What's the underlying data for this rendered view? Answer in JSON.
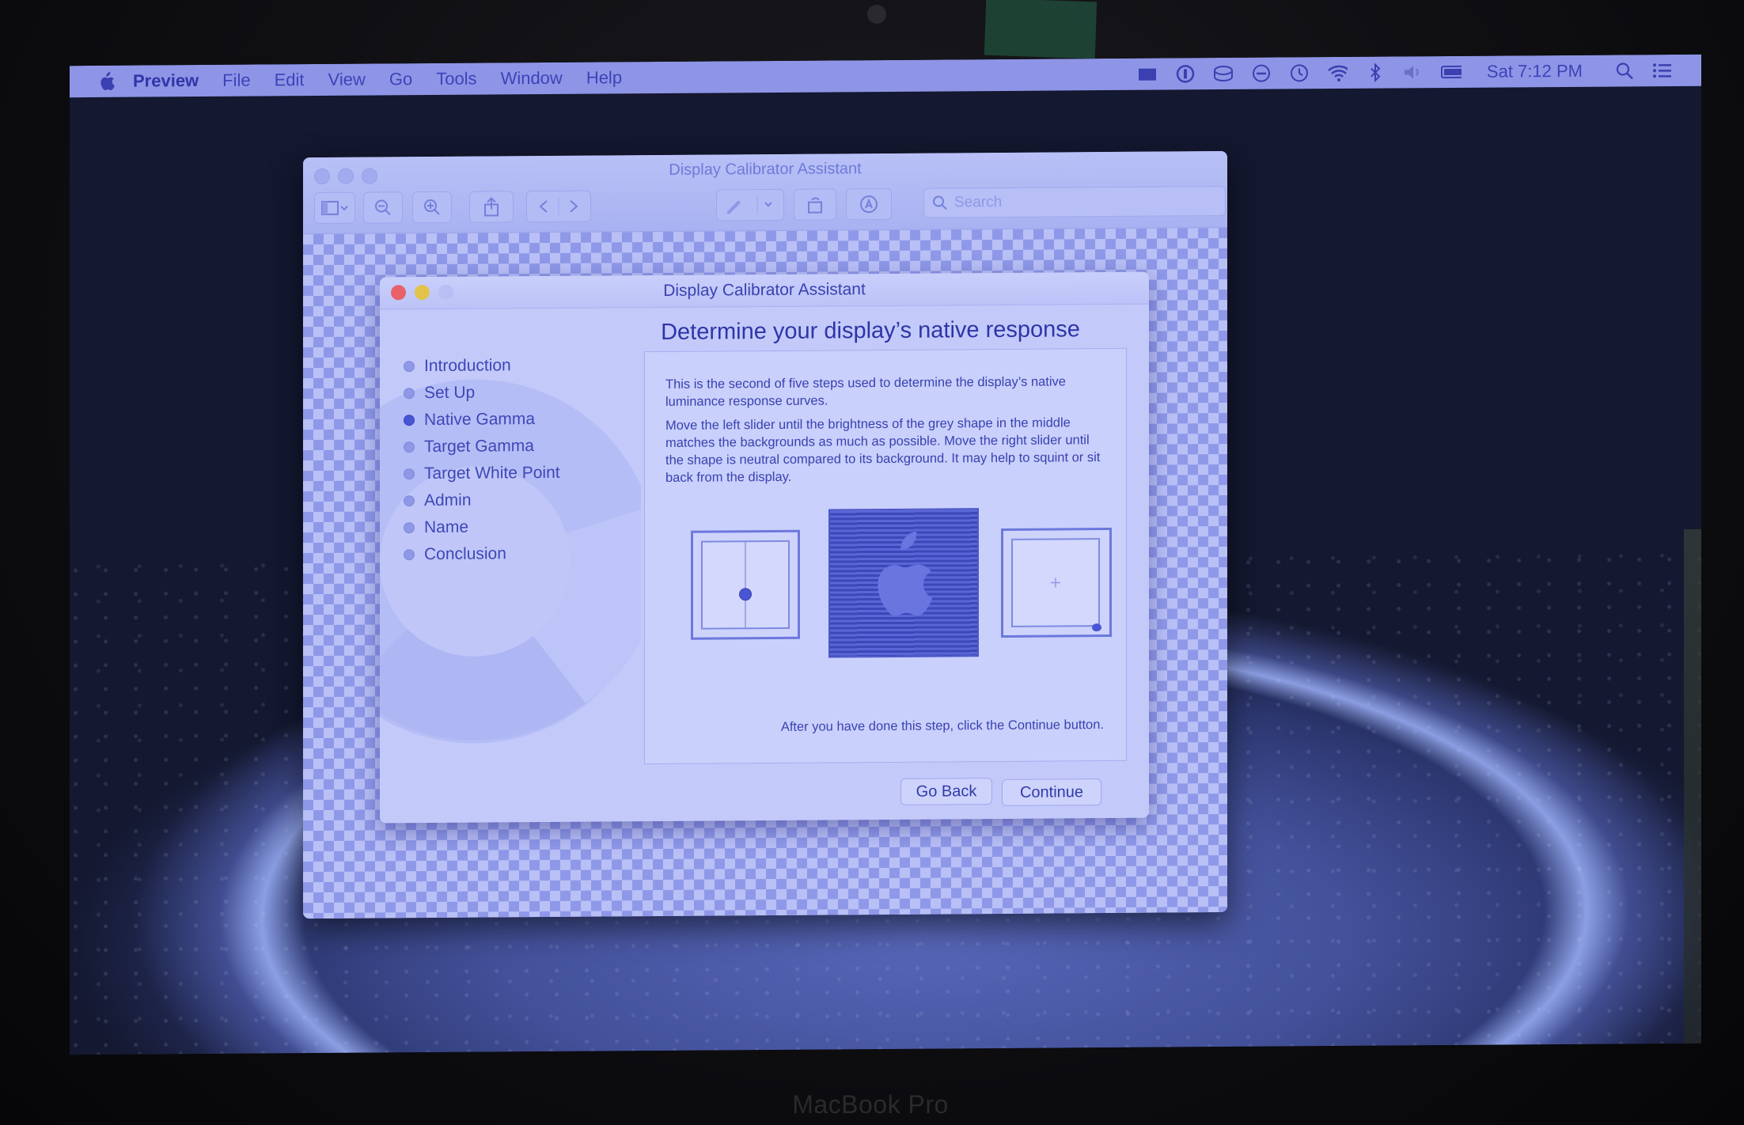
{
  "menubar": {
    "app_name": "Preview",
    "items": [
      "File",
      "Edit",
      "View",
      "Go",
      "Tools",
      "Window",
      "Help"
    ],
    "clock": "Sat 7:12 PM",
    "status_icons": [
      "screen-recording-icon",
      "password-manager-icon",
      "drive-icon",
      "do-not-disturb-icon",
      "time-machine-icon",
      "wifi-icon",
      "bluetooth-icon",
      "volume-icon",
      "battery-icon",
      "spotlight-search-icon",
      "notification-center-icon"
    ]
  },
  "preview_window": {
    "title": "Display Calibrator Assistant",
    "search_placeholder": "Search"
  },
  "dialog": {
    "title": "Display Calibrator Assistant",
    "heading": "Determine your display’s native response",
    "steps": [
      {
        "label": "Introduction",
        "current": false
      },
      {
        "label": "Set Up",
        "current": false
      },
      {
        "label": "Native Gamma",
        "current": true
      },
      {
        "label": "Target Gamma",
        "current": false
      },
      {
        "label": "Target White Point",
        "current": false
      },
      {
        "label": "Admin",
        "current": false
      },
      {
        "label": "Name",
        "current": false
      },
      {
        "label": "Conclusion",
        "current": false
      }
    ],
    "paragraph1": "This is the second of five steps used to determine the display’s native luminance response curves.",
    "paragraph2": "Move the left slider until the brightness of the grey shape in the middle matches the backgrounds as much as possible.  Move the right slider until the shape is neutral compared to its background.  It may help to squint or sit back from the display.",
    "after_text": "After you have done this step, click the Continue button.",
    "go_back_label": "Go Back",
    "continue_label": "Continue"
  },
  "device_label": "MacBook Pro",
  "colors": {
    "menubar": "#8e95e6",
    "dialog_text": "#3a41b0",
    "close_dot": "#e8606a",
    "minimize_dot": "#e3c24a"
  }
}
